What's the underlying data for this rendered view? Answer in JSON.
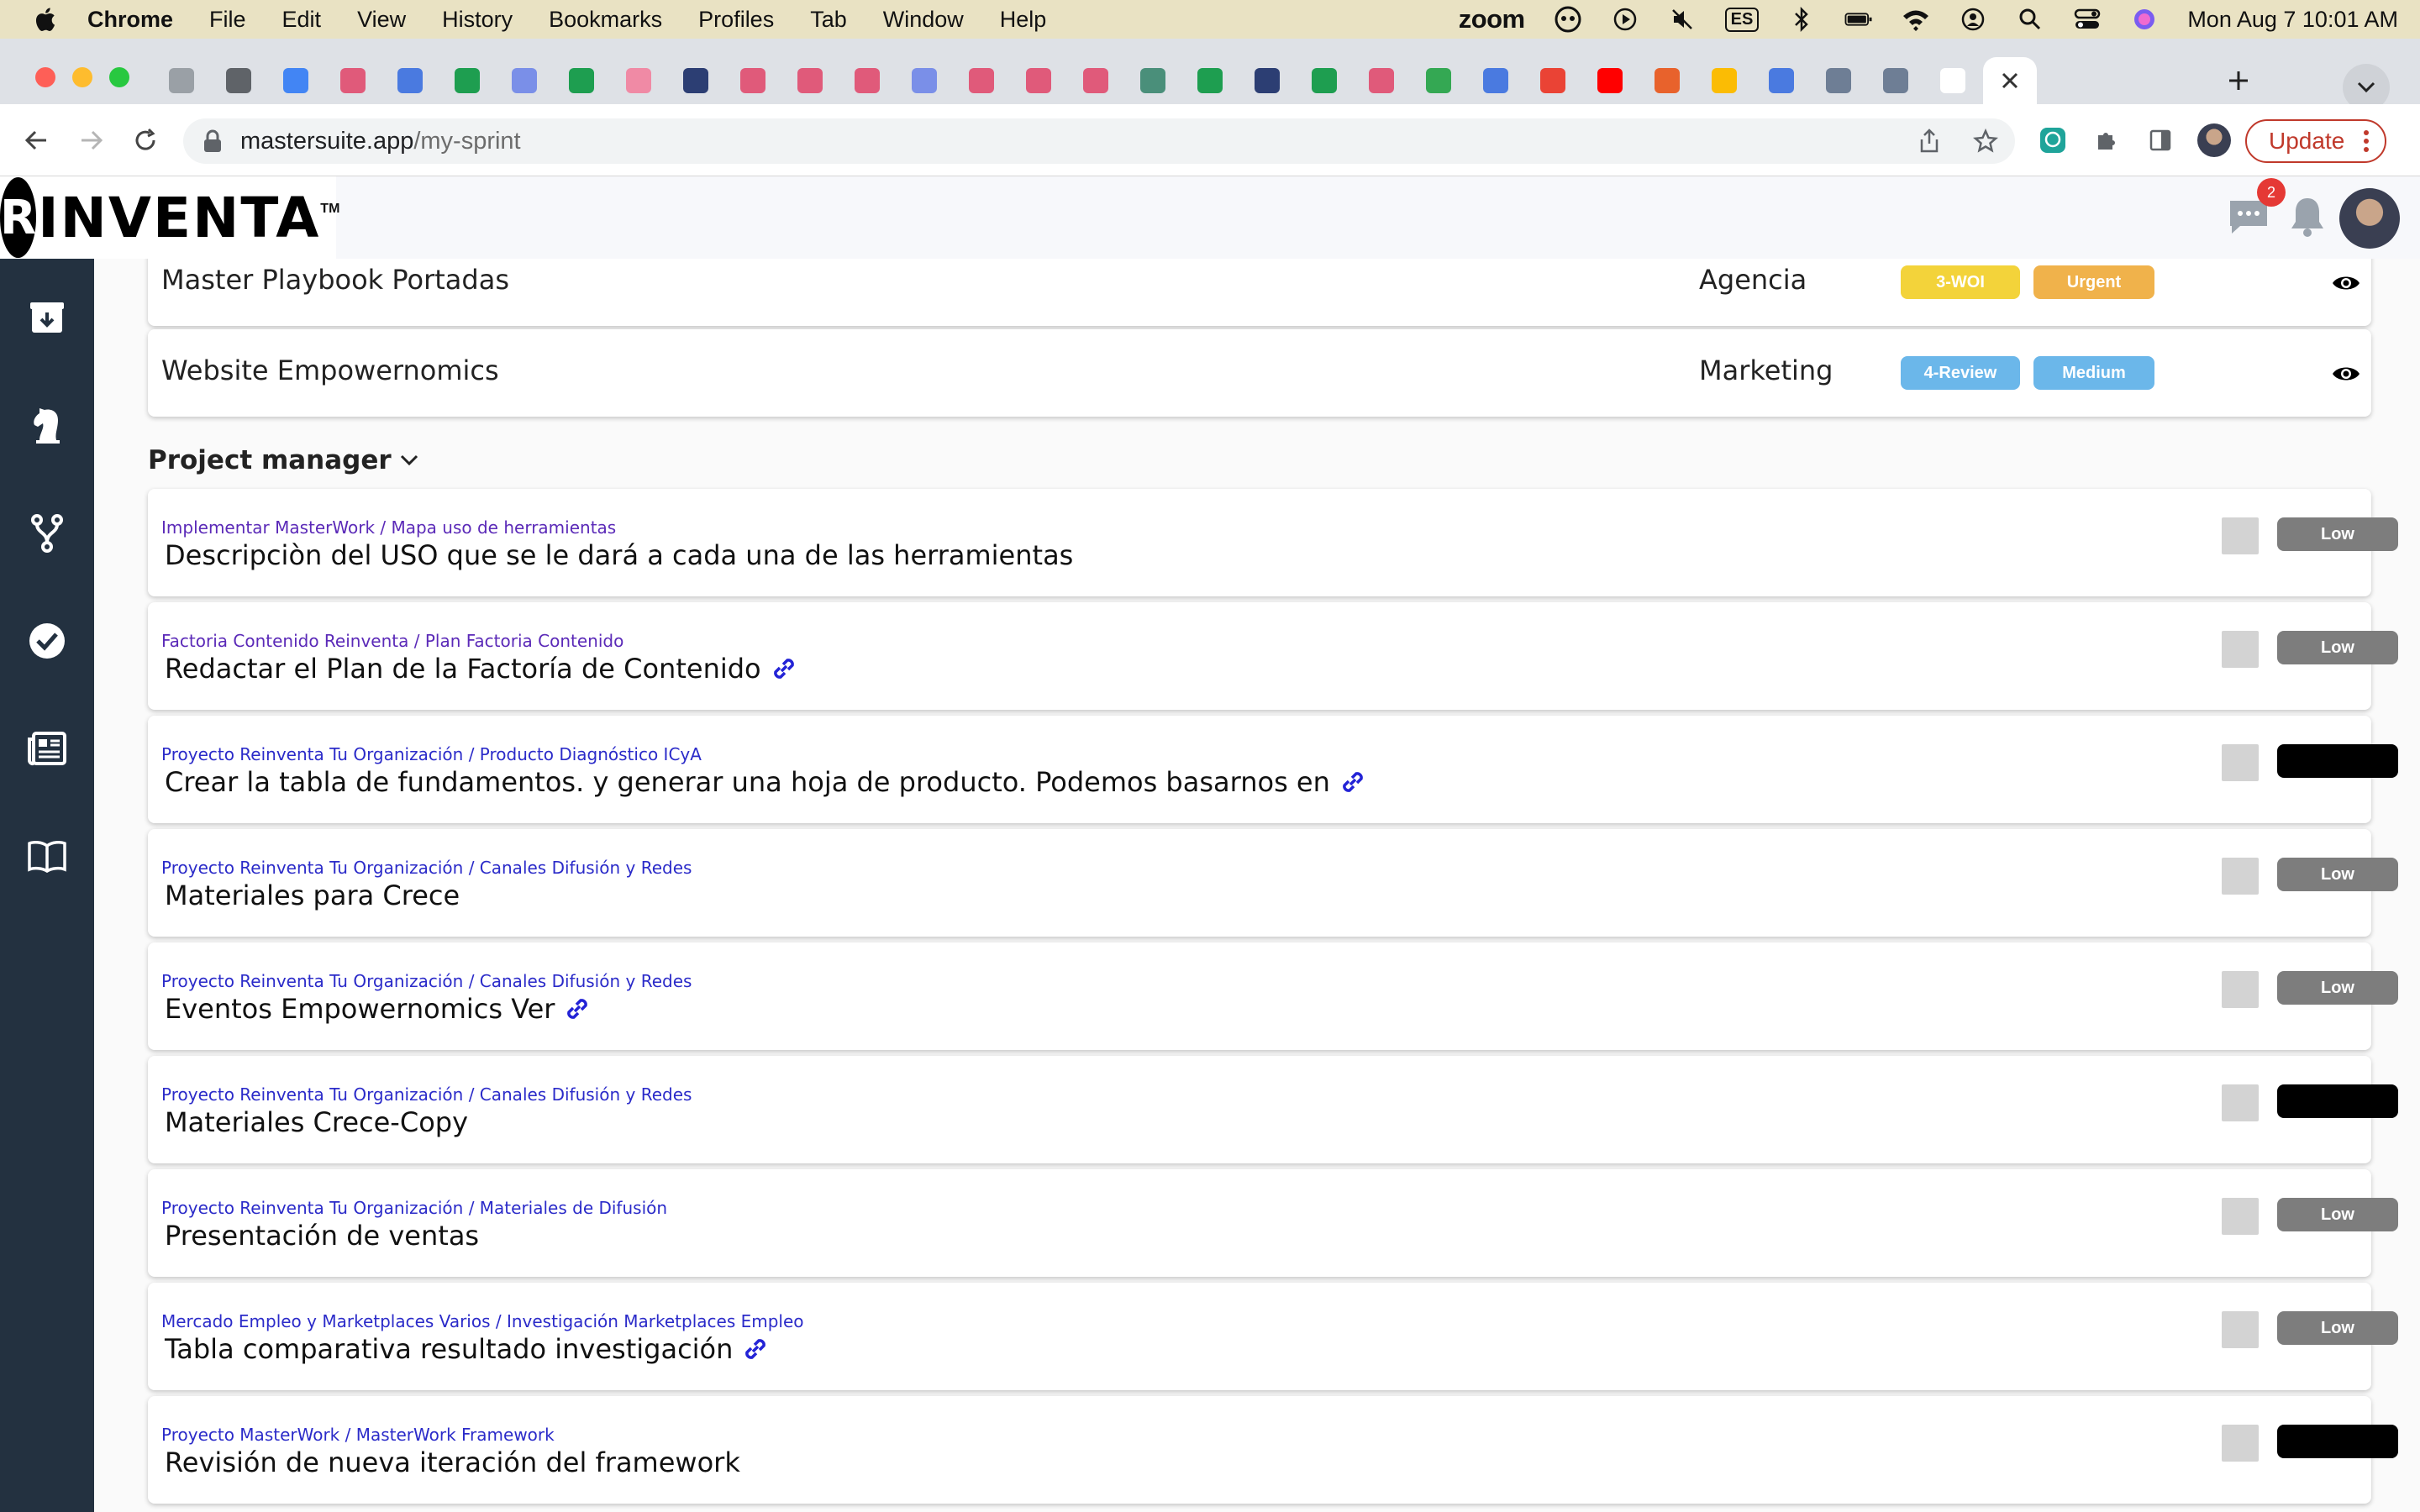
{
  "menubar": {
    "app_name": "Chrome",
    "items": [
      "File",
      "Edit",
      "View",
      "History",
      "Bookmarks",
      "Profiles",
      "Tab",
      "Window",
      "Help"
    ],
    "zoom_label": "zoom",
    "input_source": "ES",
    "datetime": "Mon Aug 7  10:01 AM"
  },
  "browser": {
    "url_host": "mastersuite.app",
    "url_path": "/my-sprint",
    "update_label": "Update",
    "tab_count": 33
  },
  "app": {
    "logo_letter": "R",
    "logo_text": "INVENTA",
    "logo_tm": "TM",
    "message_count": "2"
  },
  "sprint_items": [
    {
      "title": "Master Playbook Portadas",
      "area": "Agencia",
      "status": "3-WOI",
      "status_color": "#f3d33a",
      "priority": "Urgent",
      "priority_color": "#f0b24b"
    },
    {
      "title": "Website Empowernomics",
      "area": "Marketing",
      "status": "4-Review",
      "status_color": "#6bb7ea",
      "priority": "Medium",
      "priority_color": "#6bb7ea"
    }
  ],
  "section": {
    "title": "Project manager"
  },
  "tasks": [
    {
      "crumb": "Implementar MasterWork / Mapa uso de herramientas",
      "title": "Descripciòn del USO que se le dará a cada una de las herramientas",
      "has_link": false,
      "priority": "Low"
    },
    {
      "crumb": "Factoria Contenido Reinventa / Plan Factoria Contenido",
      "title": "Redactar el Plan de la Factoría de Contenido",
      "has_link": true,
      "priority": "Low"
    },
    {
      "crumb": "Proyecto Reinventa Tu Organización / Producto Diagnóstico ICyA",
      "title": "Crear la tabla de fundamentos. y generar una hoja de producto. Podemos basarnos en",
      "has_link": true,
      "priority": ""
    },
    {
      "crumb": "Proyecto Reinventa Tu Organización / Canales Difusión y Redes",
      "title": "Materiales para Crece",
      "has_link": false,
      "priority": "Low"
    },
    {
      "crumb": "Proyecto Reinventa Tu Organización / Canales Difusión y Redes",
      "title": "Eventos Empowernomics Ver",
      "has_link": true,
      "priority": "Low"
    },
    {
      "crumb": "Proyecto Reinventa Tu Organización / Canales Difusión y Redes",
      "title": "Materiales Crece-Copy",
      "has_link": false,
      "priority": ""
    },
    {
      "crumb": "Proyecto Reinventa Tu Organización / Materiales de Difusión",
      "title": "Presentación de ventas",
      "has_link": false,
      "priority": "Low"
    },
    {
      "crumb": "Mercado Empleo y Marketplaces Varios / Investigación Marketplaces Empleo",
      "title": "Tabla comparativa resultado investigación",
      "has_link": true,
      "priority": "Low"
    },
    {
      "crumb": "Proyecto MasterWork / MasterWork Framework",
      "title": "Revisión de nueva iteración del framework",
      "has_link": false,
      "priority": ""
    }
  ],
  "sidebar_icons": [
    "inbox-icon",
    "chess-knight-icon",
    "fork-icon",
    "check-circle-icon",
    "newspaper-icon",
    "book-icon"
  ]
}
